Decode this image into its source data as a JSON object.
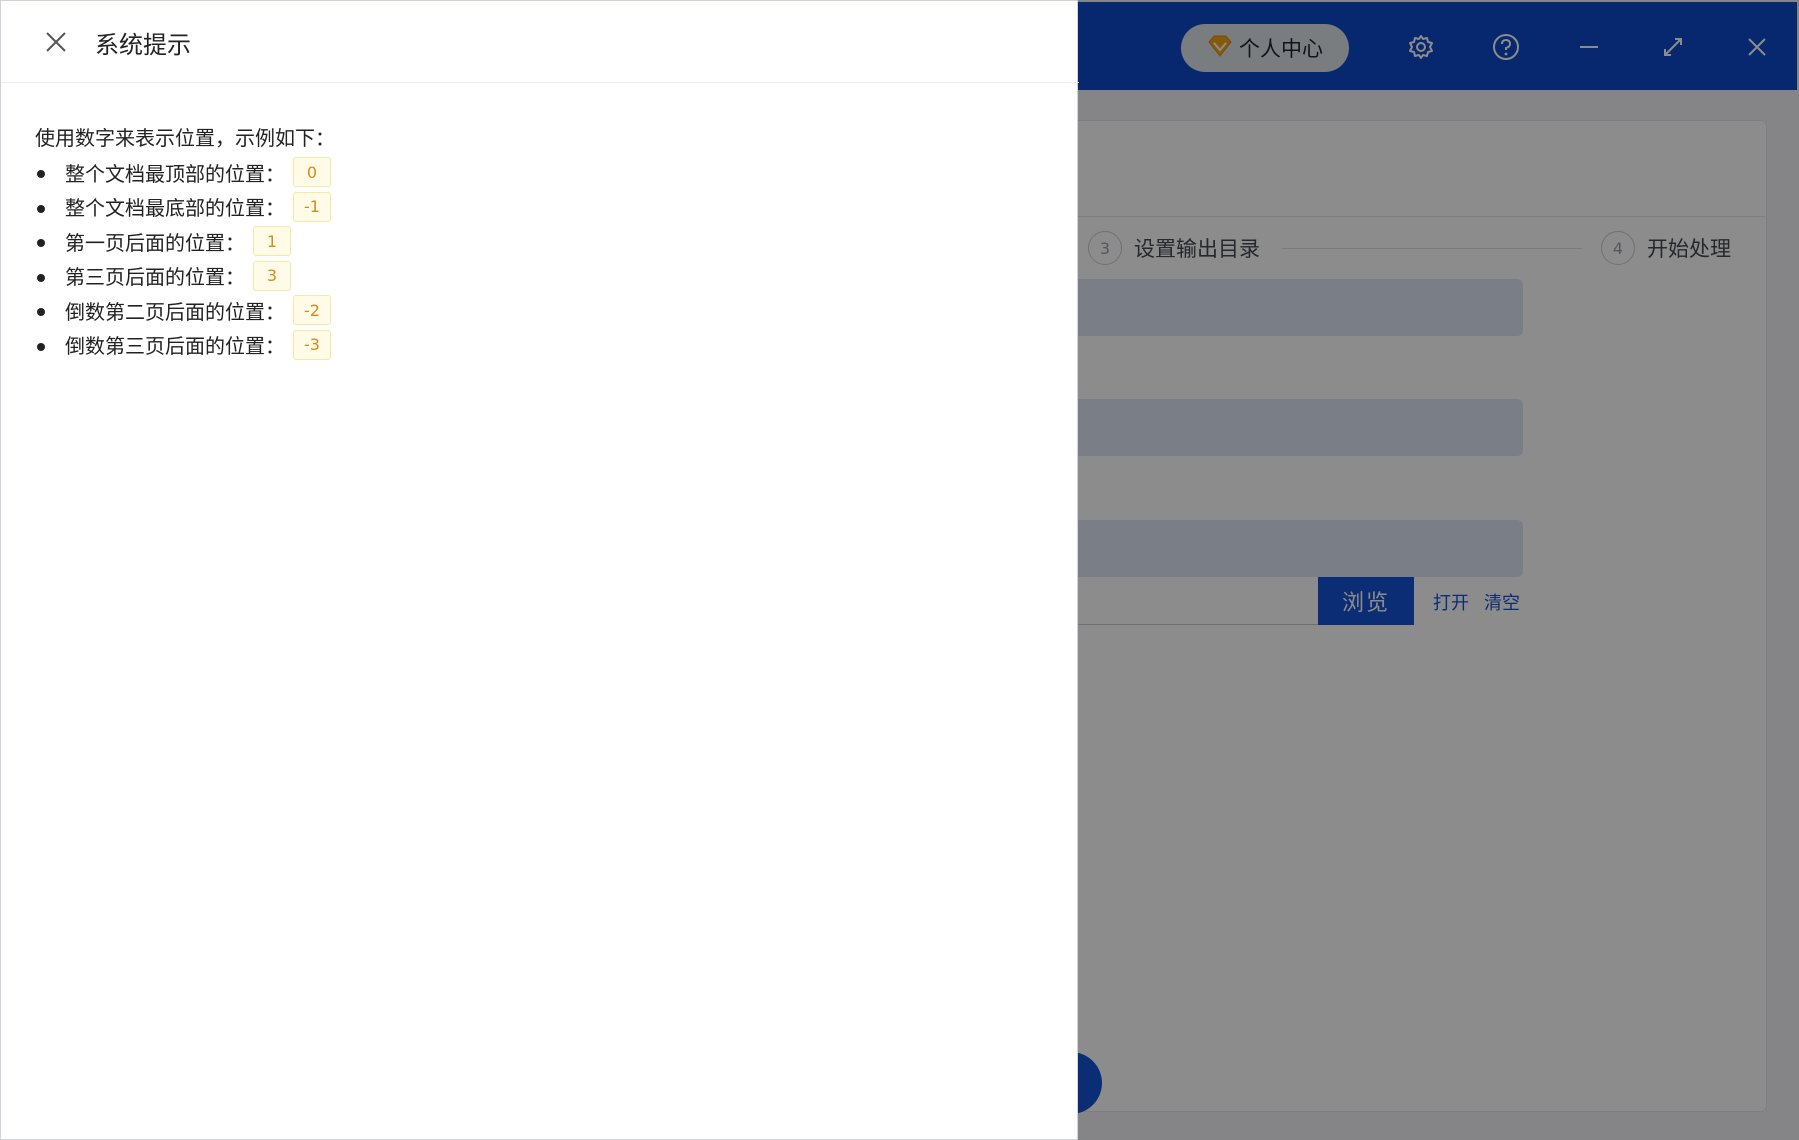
{
  "window": {
    "vip_label": "个人中心",
    "icons": [
      "gem-icon",
      "gear-icon",
      "help-icon",
      "minimize-icon",
      "maximize-icon",
      "close-icon"
    ]
  },
  "steps": [
    {
      "num": "3",
      "label": "设置输出目录"
    },
    {
      "num": "4",
      "label": "开始处理"
    }
  ],
  "actions": {
    "browse": "浏览",
    "open": "打开",
    "clear": "清空"
  },
  "dialog": {
    "title": "系统提示",
    "intro": "使用数字来表示位置，示例如下：",
    "examples": [
      {
        "text": "整个文档最顶部的位置：",
        "code": "0"
      },
      {
        "text": "整个文档最底部的位置：",
        "code": "-1"
      },
      {
        "text": "第一页后面的位置：",
        "code": "1"
      },
      {
        "text": "第三页后面的位置：",
        "code": "3"
      },
      {
        "text": "倒数第二页后面的位置：",
        "code": "-2"
      },
      {
        "text": "倒数第三页后面的位置：",
        "code": "-3"
      }
    ]
  },
  "colors": {
    "brand": "#0d47c9",
    "primary": "#1352d6",
    "code_text": "#d68a1b",
    "code_bg": "#fffbe6"
  }
}
